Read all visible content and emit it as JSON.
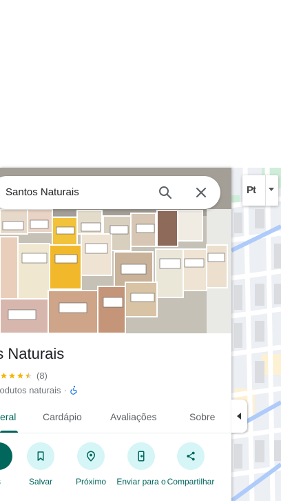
{
  "search": {
    "query": "Santos Naturais"
  },
  "place": {
    "title": "os Naturais",
    "rating": 4.5,
    "review_count": "(8)",
    "category": "produtos naturais",
    "separator": "·"
  },
  "tabs": [
    {
      "label": "eral",
      "active": true
    },
    {
      "label": "Cardápio",
      "active": false
    },
    {
      "label": "Avaliações",
      "active": false
    },
    {
      "label": "Sobre",
      "active": false
    }
  ],
  "actions": [
    {
      "label": "s",
      "icon": "directions-icon"
    },
    {
      "label": "Salvar",
      "icon": "bookmark-icon"
    },
    {
      "label": "Próximo",
      "icon": "nearby-icon"
    },
    {
      "label": "Enviar para o",
      "icon": "send-to-phone-icon"
    },
    {
      "label": "Compartilhar",
      "icon": "share-icon"
    }
  ],
  "map": {
    "layer_label": "Pt"
  },
  "colors": {
    "accent": "#01665c",
    "action_bg": "#d5f5f6",
    "star": "#f4b400"
  }
}
